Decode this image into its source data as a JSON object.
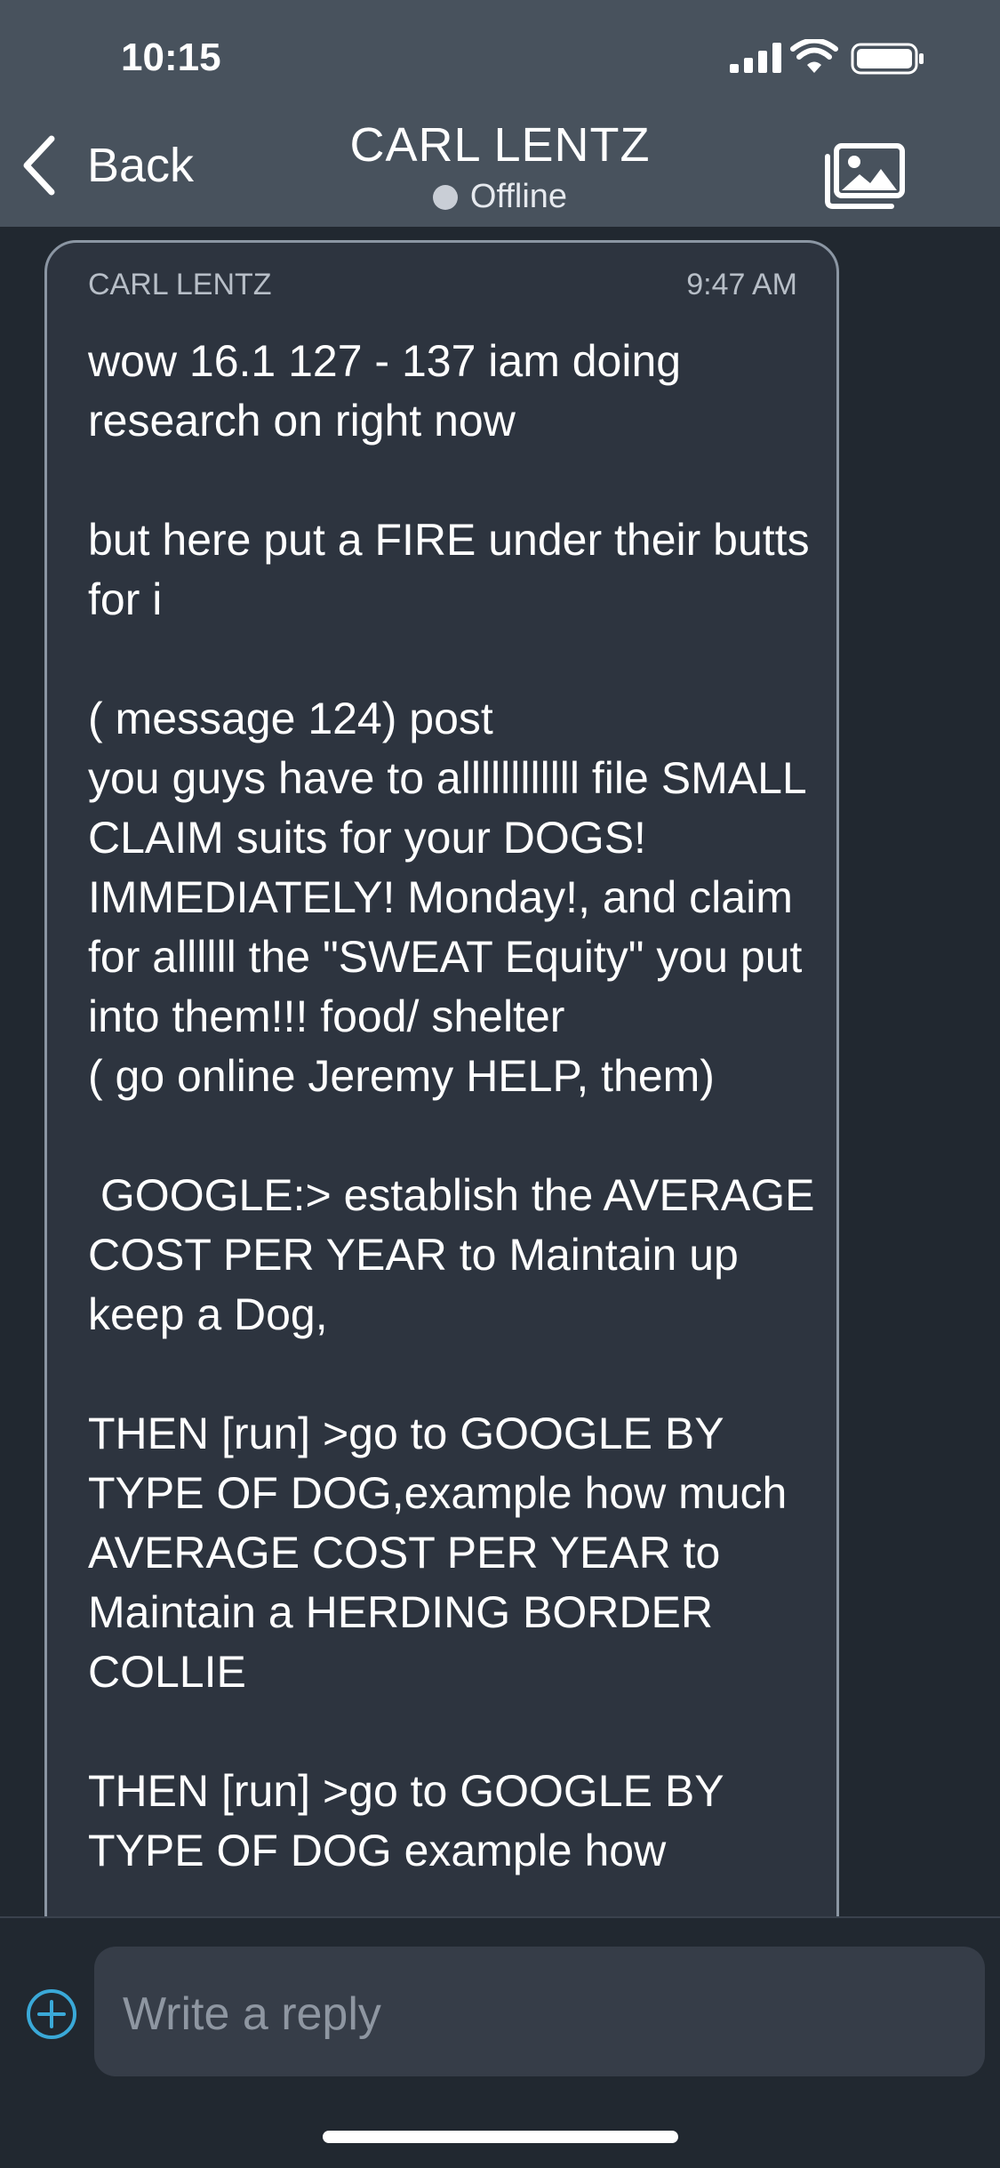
{
  "status_bar": {
    "time": "10:15"
  },
  "nav": {
    "back_label": "Back",
    "title": "CARL LENTZ",
    "presence": "Offline"
  },
  "message": {
    "sender": "CARL LENTZ",
    "time": "9:47 AM",
    "body": "wow 16.1 127 - 137 iam doing research on right now\n\nbut here put a FIRE under their butts for i\n\n( message 124) post\nyou guys have to allllllllllll file SMALL CLAIM suits for your DOGS! IMMEDIATELY! Monday!, and claim for allllll the \"SWEAT Equity\" you put into them!!! food/ shelter\n( go online Jeremy HELP, them)\n\n GOOGLE:> establish the AVERAGE COST PER YEAR to Maintain up keep a Dog,\n\nTHEN [run] >go to GOOGLE BY TYPE OF DOG,example how much AVERAGE COST PER YEAR to Maintain a HERDING BORDER COLLIE\n\nTHEN [run] >go to GOOGLE BY TYPE OF DOG example how"
  },
  "composer": {
    "placeholder": "Write a reply"
  },
  "icons": {
    "back": "chevron-left-icon",
    "gallery": "photo-gallery-icon",
    "add": "plus-circle-icon"
  },
  "colors": {
    "accent": "#3aa9d8",
    "header": "#48525d",
    "background": "#212830"
  }
}
